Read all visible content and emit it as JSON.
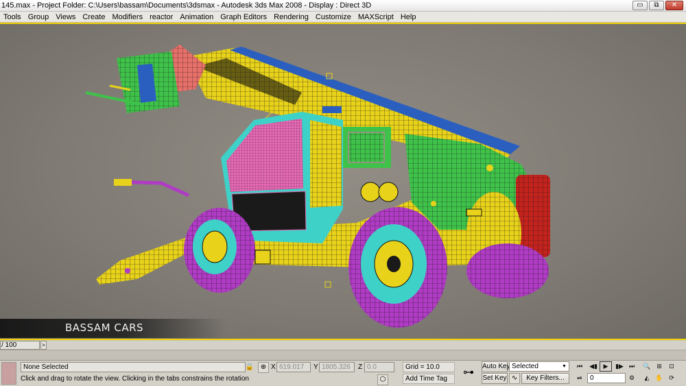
{
  "titlebar": {
    "title": "145.max   - Project Folder: C:\\Users\\bassam\\Documents\\3dsmax      - Autodesk 3ds Max 2008      - Display : Direct 3D",
    "minimize": "▭",
    "maximize": "⧉",
    "close": "✕"
  },
  "menu": [
    "Tools",
    "Group",
    "Views",
    "Create",
    "Modifiers",
    "reactor",
    "Animation",
    "Graph Editors",
    "Rendering",
    "Customize",
    "MAXScript",
    "Help"
  ],
  "viewport": {
    "watermark": "BASSAM CARS"
  },
  "timeslider": {
    "frame": "/ 100",
    "arrow": ">"
  },
  "status": {
    "selection": "None Selected",
    "prompt": "Click and drag to rotate the view.  Clicking in the tabs constrains the rotation",
    "x_label": "X",
    "x_value": "619.017",
    "y_label": "Y",
    "y_value": "1805.326",
    "z_label": "Z",
    "z_value": "0.0",
    "grid": "Grid = 10.0",
    "add_time_tag": "Add Time Tag",
    "auto_key": "Auto Key",
    "set_key": "Set Key",
    "selected_dropdown": "Selected",
    "key_filters": "Key Filters...",
    "current_frame": "0"
  },
  "colors": {
    "viewport_border": "#f2d200",
    "wire_yellow": "#e8d21a",
    "wire_green": "#3fc24a",
    "wire_magenta": "#b03bc4",
    "wire_pink": "#e66ab4",
    "wire_cyan": "#3ed1c8",
    "wire_red": "#c4231d",
    "wire_blue": "#2b5fbf",
    "wire_salmon": "#e8706a"
  }
}
